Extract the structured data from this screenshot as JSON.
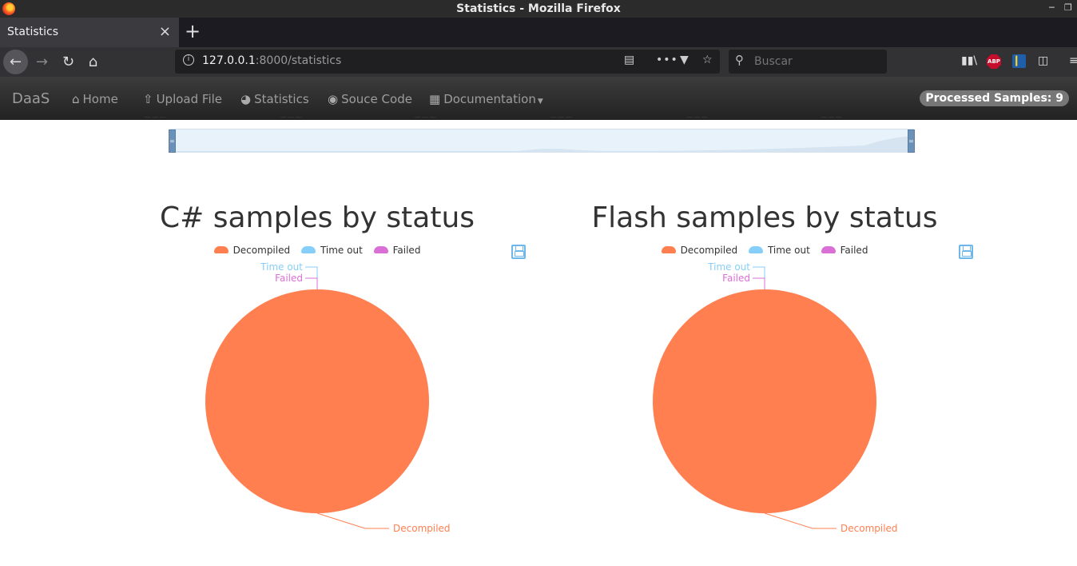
{
  "window": {
    "title": "Statistics - Mozilla Firefox"
  },
  "tab": {
    "label": "Statistics",
    "close": "×",
    "new_tab": "+"
  },
  "urlbar": {
    "host": "127.0.0.1",
    "rest": ":8000/statistics"
  },
  "search": {
    "placeholder": "Buscar"
  },
  "navbar": {
    "brand": "DaaS",
    "items": [
      "Home",
      "Upload File",
      "Statistics",
      "Souce Code",
      "Documentation"
    ],
    "badge": "Processed Samples: 9"
  },
  "colors": {
    "decompiled": "#ff7f50",
    "time_out": "#87cefa",
    "failed": "#da70d6"
  },
  "chart_data": [
    {
      "type": "pie",
      "title": "C# samples by status",
      "legend": [
        "Decompiled",
        "Time out",
        "Failed"
      ],
      "values": [
        {
          "name": "Decompiled",
          "value": 9
        },
        {
          "name": "Time out",
          "value": 0
        },
        {
          "name": "Failed",
          "value": 0
        }
      ]
    },
    {
      "type": "pie",
      "title": "Flash samples by status",
      "legend": [
        "Decompiled",
        "Time out",
        "Failed"
      ],
      "values": [
        {
          "name": "Decompiled",
          "value": 9
        },
        {
          "name": "Time out",
          "value": 0
        },
        {
          "name": "Failed",
          "value": 0
        }
      ]
    }
  ]
}
